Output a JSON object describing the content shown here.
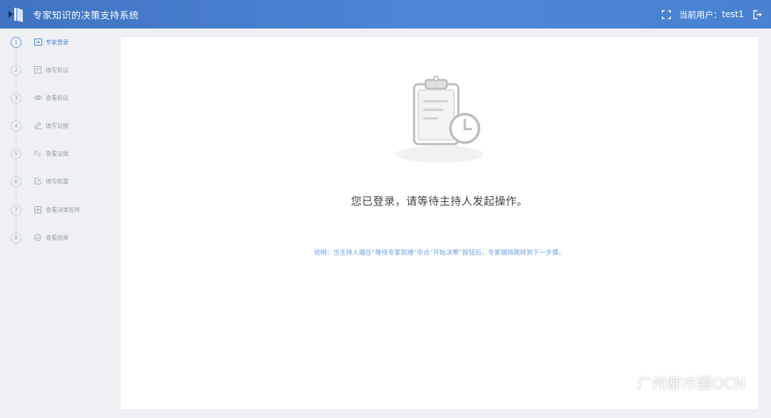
{
  "header": {
    "app_title": "专家知识的决策支持系统",
    "current_user_label": "当前用户：",
    "username": "test1",
    "icons": [
      "fullscreen-icon",
      "logout-icon"
    ]
  },
  "sidebar": {
    "steps": [
      {
        "num": "1",
        "label": "专家登录",
        "icon": "login-icon",
        "active": true
      },
      {
        "num": "2",
        "label": "填写假设",
        "icon": "form-icon",
        "active": false
      },
      {
        "num": "3",
        "label": "查看假设",
        "icon": "eye-icon",
        "active": false
      },
      {
        "num": "4",
        "label": "填写证据",
        "icon": "edit-icon",
        "active": false
      },
      {
        "num": "5",
        "label": "查看证据",
        "icon": "list-icon",
        "active": false
      },
      {
        "num": "6",
        "label": "填写权重",
        "icon": "edit-box-icon",
        "active": false
      },
      {
        "num": "7",
        "label": "查看决策矩阵",
        "icon": "matrix-icon",
        "active": false
      },
      {
        "num": "8",
        "label": "查看结果",
        "icon": "result-icon",
        "active": false
      }
    ]
  },
  "main": {
    "message": "您已登录，请等待主持人发起操作。",
    "note": "说明：当主持人端在“等待专家就绪”中点“开始决策”按钮后，专家端将跳转到下一步骤。",
    "illustration_icon": "clipboard-clock-icon"
  },
  "watermark": {
    "text": "广州都市圈OCN",
    "icon": "wechat-icon"
  },
  "colors": {
    "header": "#4a82d2",
    "accent": "#4a86d6",
    "background": "#eef0f4"
  }
}
